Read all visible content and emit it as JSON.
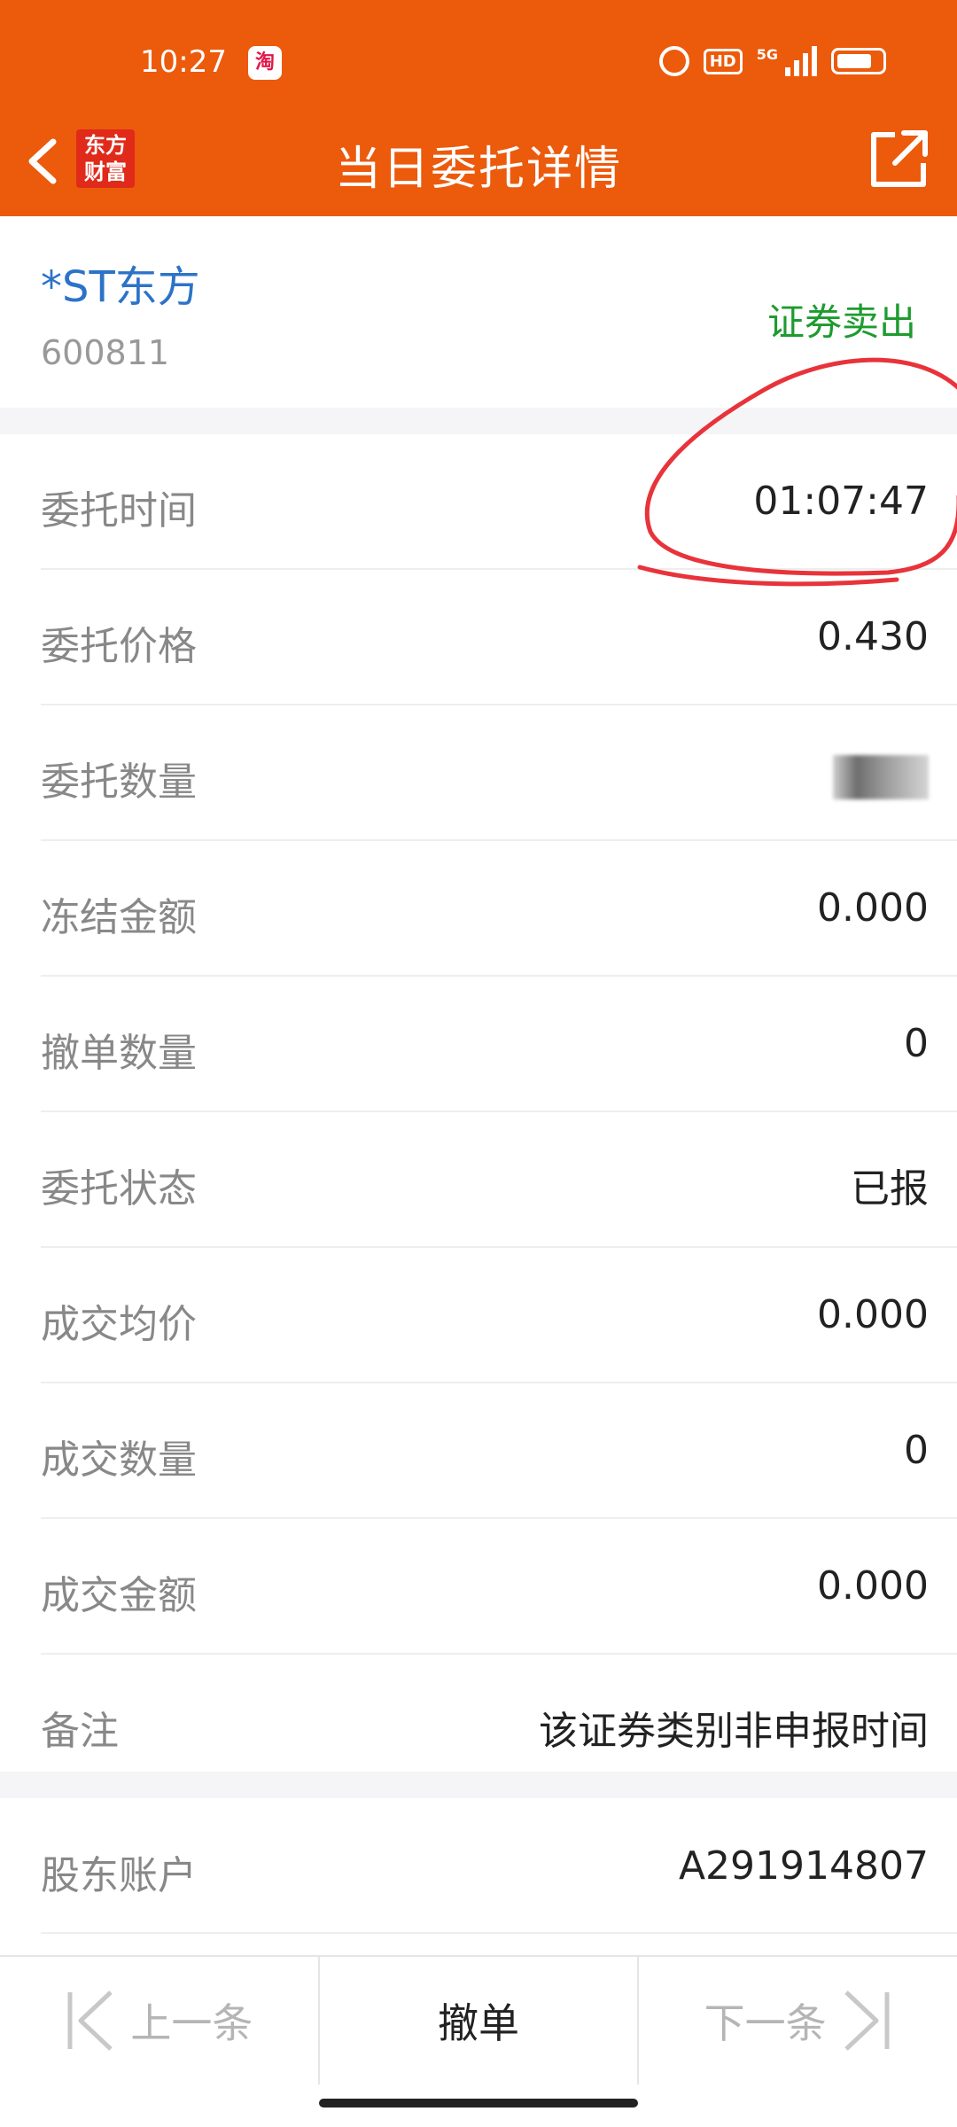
{
  "status_bar": {
    "time": "10:27",
    "app_badge": "淘",
    "network": "5G",
    "hd": "HD"
  },
  "title_bar": {
    "logo_line1": "东方",
    "logo_line2": "财富",
    "title": "当日委托详情"
  },
  "stock": {
    "name": "*ST东方",
    "code": "600811",
    "trade_type": "证券卖出"
  },
  "details": [
    {
      "label": "委托时间",
      "value": "01:07:47"
    },
    {
      "label": "委托价格",
      "value": "0.430"
    },
    {
      "label": "委托数量",
      "value": ""
    },
    {
      "label": "冻结金额",
      "value": "0.000"
    },
    {
      "label": "撤单数量",
      "value": "0"
    },
    {
      "label": "委托状态",
      "value": "已报"
    },
    {
      "label": "成交均价",
      "value": "0.000"
    },
    {
      "label": "成交数量",
      "value": "0"
    },
    {
      "label": "成交金额",
      "value": "0.000"
    },
    {
      "label": "备注",
      "value": "该证券类别非申报时间"
    }
  ],
  "account": {
    "label": "股东账户",
    "value": "A291914807"
  },
  "bottom_bar": {
    "prev": "上一条",
    "cancel": "撤单",
    "next": "下一条"
  },
  "colors": {
    "header": "#ec5a0c",
    "stock_name": "#2c73c8",
    "trade_type": "#1e9b2e",
    "annotation": "#e8333a"
  }
}
